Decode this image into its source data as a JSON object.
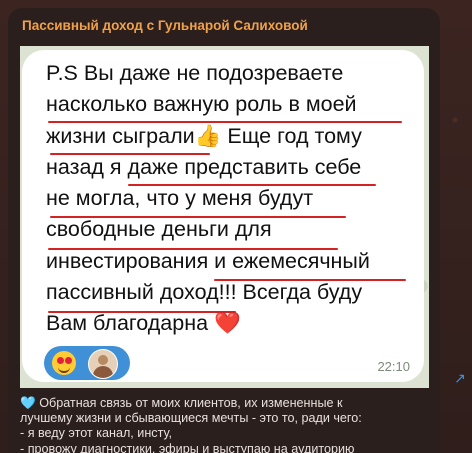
{
  "channel": {
    "title": "Пассивный доход с Гульнарой Салиховой"
  },
  "screenshot_message": {
    "lines": [
      "P.S Вы даже не подозреваете",
      "насколько важную роль в моей",
      "жизни сыграли",
      "Еще год тому",
      "назад я даже представить себе",
      "не могла, что у меня будут",
      "свободные деньги для",
      "инвестирования и ежемесячный",
      "пассивный доход!!! Всегда буду",
      "Вам благодарна"
    ],
    "thumb_emoji": "👍",
    "heart_emoji": "❤️",
    "time": "22:10",
    "accent_underline": "#d42222",
    "reaction_color": "#3f90d6"
  },
  "caption": {
    "heart": "🩵",
    "lines": [
      "Обратная связь от моих клиентов, их измененные к",
      "лучшему жизни и сбывающиеся мечты - это то, ради чего:",
      "- я веду этот канал, инсту,",
      "- провожу диагностики, эфиры и выступаю на аудиторию"
    ]
  }
}
